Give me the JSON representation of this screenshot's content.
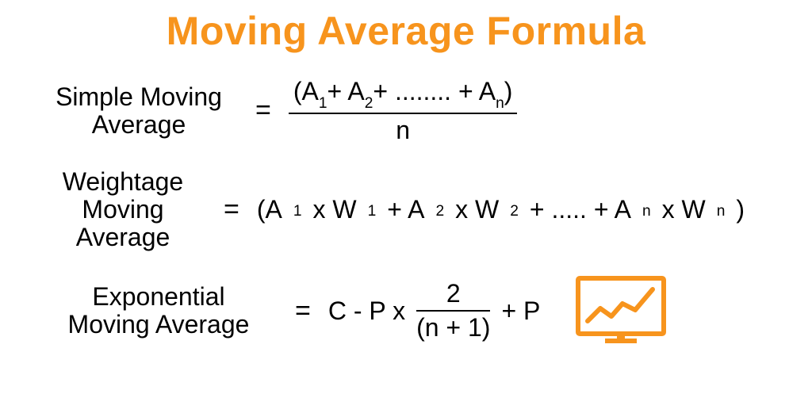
{
  "colors": {
    "accent": "#f7941d"
  },
  "title": "Moving Average Formula",
  "formulas": {
    "sma": {
      "label_l1": "Simple Moving",
      "label_l2": "Average",
      "eq": "=",
      "numerator_html": "(A<sub>1</sub>+ A<sub>2</sub>+ ........ + A<sub>n</sub>)",
      "denominator": "n"
    },
    "wma": {
      "label_l1": "Weightage",
      "label_l2": "Moving",
      "label_l3": "Average",
      "eq": "=",
      "expression_html": "(A<sub>1</sub> x W<sub>1</sub> + A<sub>2</sub> x W<sub>2</sub> + ..... + A<sub>n</sub> x W<sub>n</sub>)"
    },
    "ema": {
      "label_l1": "Exponential",
      "label_l2": "Moving Average",
      "eq": "=",
      "left_text": "C - P x",
      "frac_num": "2",
      "frac_den": "(n + 1)",
      "right_text": "+ P"
    }
  }
}
